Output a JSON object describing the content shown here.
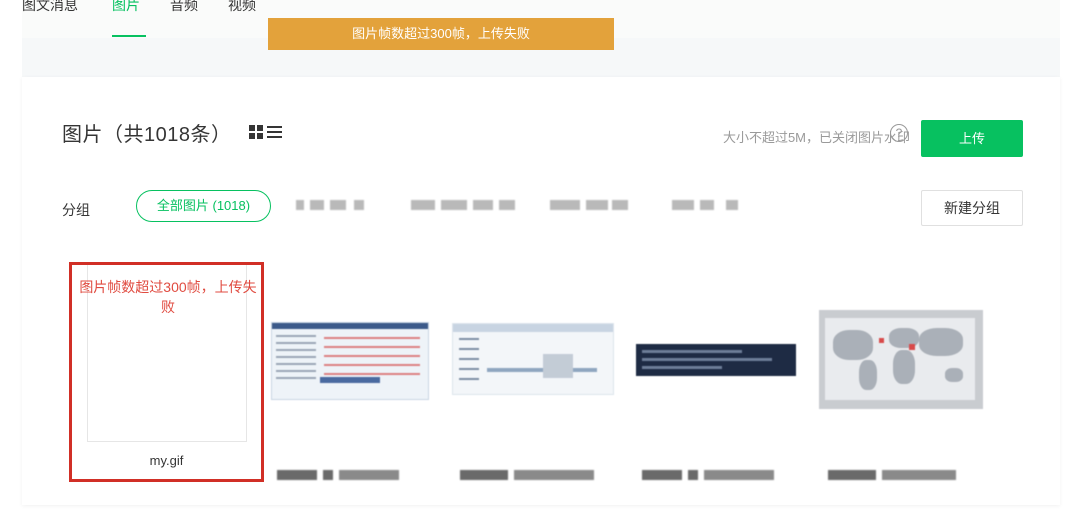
{
  "nav": {
    "tabs": [
      {
        "label": "图文消息"
      },
      {
        "label": "图片"
      },
      {
        "label": "音频"
      },
      {
        "label": "视频"
      }
    ]
  },
  "toast": {
    "message": "图片帧数超过300帧，上传失败"
  },
  "header": {
    "title": "图片（共1018条）",
    "hint": "大小不超过5M，已关闭图片水印",
    "help_glyph": "?",
    "upload_label": "上传"
  },
  "groups": {
    "label": "分组",
    "all_label": "全部图片 (1018)",
    "new_group_label": "新建分组"
  },
  "images": {
    "error_card": {
      "message": "图片帧数超过300帧，上传失败",
      "filename": "my.gif"
    }
  },
  "colors": {
    "accent": "#07c160",
    "error": "#d12f26",
    "toast": "#e3a23b"
  }
}
